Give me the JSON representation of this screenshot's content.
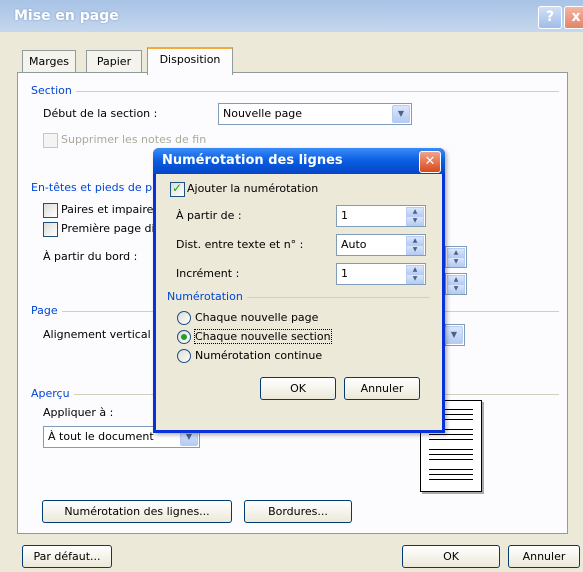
{
  "window": {
    "title": "Mise en page",
    "help_label": "?",
    "close_label": "x"
  },
  "tabs": [
    {
      "label": "Marges"
    },
    {
      "label": "Papier"
    },
    {
      "label": "Disposition"
    }
  ],
  "section": {
    "group_label": "Section",
    "start_label": "Début de la section :",
    "start_value": "Nouvelle page",
    "suppress_endnotes_label": "Supprimer les notes de fin"
  },
  "headers": {
    "group_label": "En-têtes et pieds de p",
    "odd_even_label": "Paires et impaire",
    "first_page_label": "Première page di",
    "from_edge_label": "À partir du bord :"
  },
  "page": {
    "group_label": "Page",
    "vertical_align_label": "Alignement vertical :"
  },
  "preview": {
    "group_label": "Aperçu",
    "apply_label": "Appliquer à :",
    "apply_value": "À tout le document"
  },
  "buttons": {
    "line_numbers": "Numérotation des lignes...",
    "borders": "Bordures...",
    "default": "Par défaut...",
    "ok": "OK",
    "cancel": "Annuler"
  },
  "dialog": {
    "title": "Numérotation des lignes",
    "add_numbering_label": "Ajouter la numérotation",
    "start_at_label": "À partir de :",
    "start_at_value": "1",
    "distance_label": "Dist. entre texte et n° :",
    "distance_value": "Auto",
    "increment_label": "Incrément :",
    "increment_value": "1",
    "numbering_group_label": "Numérotation",
    "options": [
      {
        "label": "Chaque nouvelle page",
        "selected": false
      },
      {
        "label": "Chaque nouvelle section",
        "selected": true
      },
      {
        "label": "Numérotation continue",
        "selected": false
      }
    ],
    "ok": "OK",
    "cancel": "Annuler"
  },
  "colors": {
    "titlebar_blue": "#0a5ddf",
    "group_label_blue": "#0046d5",
    "tab_accent": "#f3a93b",
    "close_red": "#d9481c"
  }
}
